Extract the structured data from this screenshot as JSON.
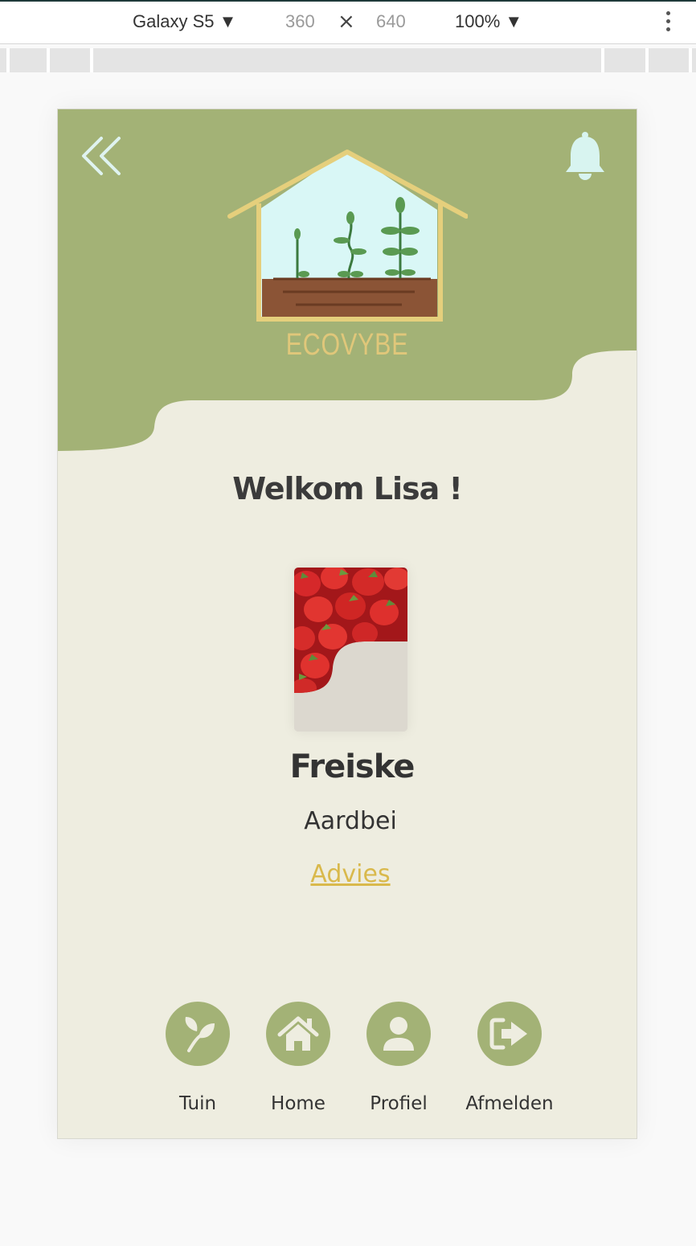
{
  "devtools": {
    "device": "Galaxy S5 ▼",
    "width": "360",
    "times": "×",
    "height": "640",
    "zoom": "100% ▼"
  },
  "app": {
    "brand": "ECOVYBE",
    "welcome": "Welkom Lisa !",
    "plant": {
      "name": "Freiske",
      "type": "Aardbei",
      "advice_link": "Advies"
    },
    "nav": [
      {
        "label": "Tuin",
        "icon": "leaf-icon"
      },
      {
        "label": "Home",
        "icon": "home-icon"
      },
      {
        "label": "Profiel",
        "icon": "user-icon"
      },
      {
        "label": "Afmelden",
        "icon": "sign-out-icon"
      }
    ]
  },
  "colors": {
    "header_green": "#a3b276",
    "background_cream": "#eeede0",
    "accent_gold": "#d9b94c",
    "bell_mint": "#d8f4f0"
  }
}
